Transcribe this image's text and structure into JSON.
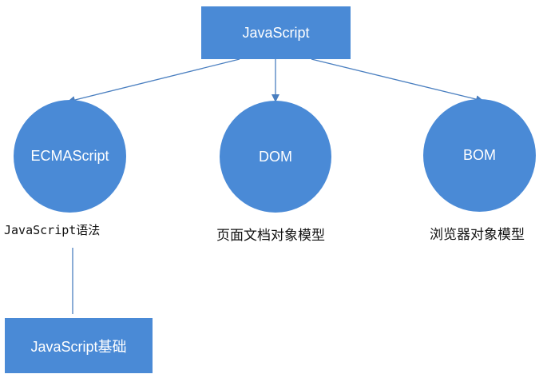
{
  "diagram": {
    "root": {
      "label": "JavaScript"
    },
    "children": [
      {
        "label": "ECMAScript",
        "caption": "JavaScript语法"
      },
      {
        "label": "DOM",
        "caption": "页面文档对象模型"
      },
      {
        "label": "BOM",
        "caption": "浏览器对象模型"
      }
    ],
    "leaf": {
      "label": "JavaScript基础"
    },
    "colors": {
      "node_fill": "#4a8ad6",
      "node_text": "#ffffff",
      "connector": "#4a7fc0"
    }
  }
}
